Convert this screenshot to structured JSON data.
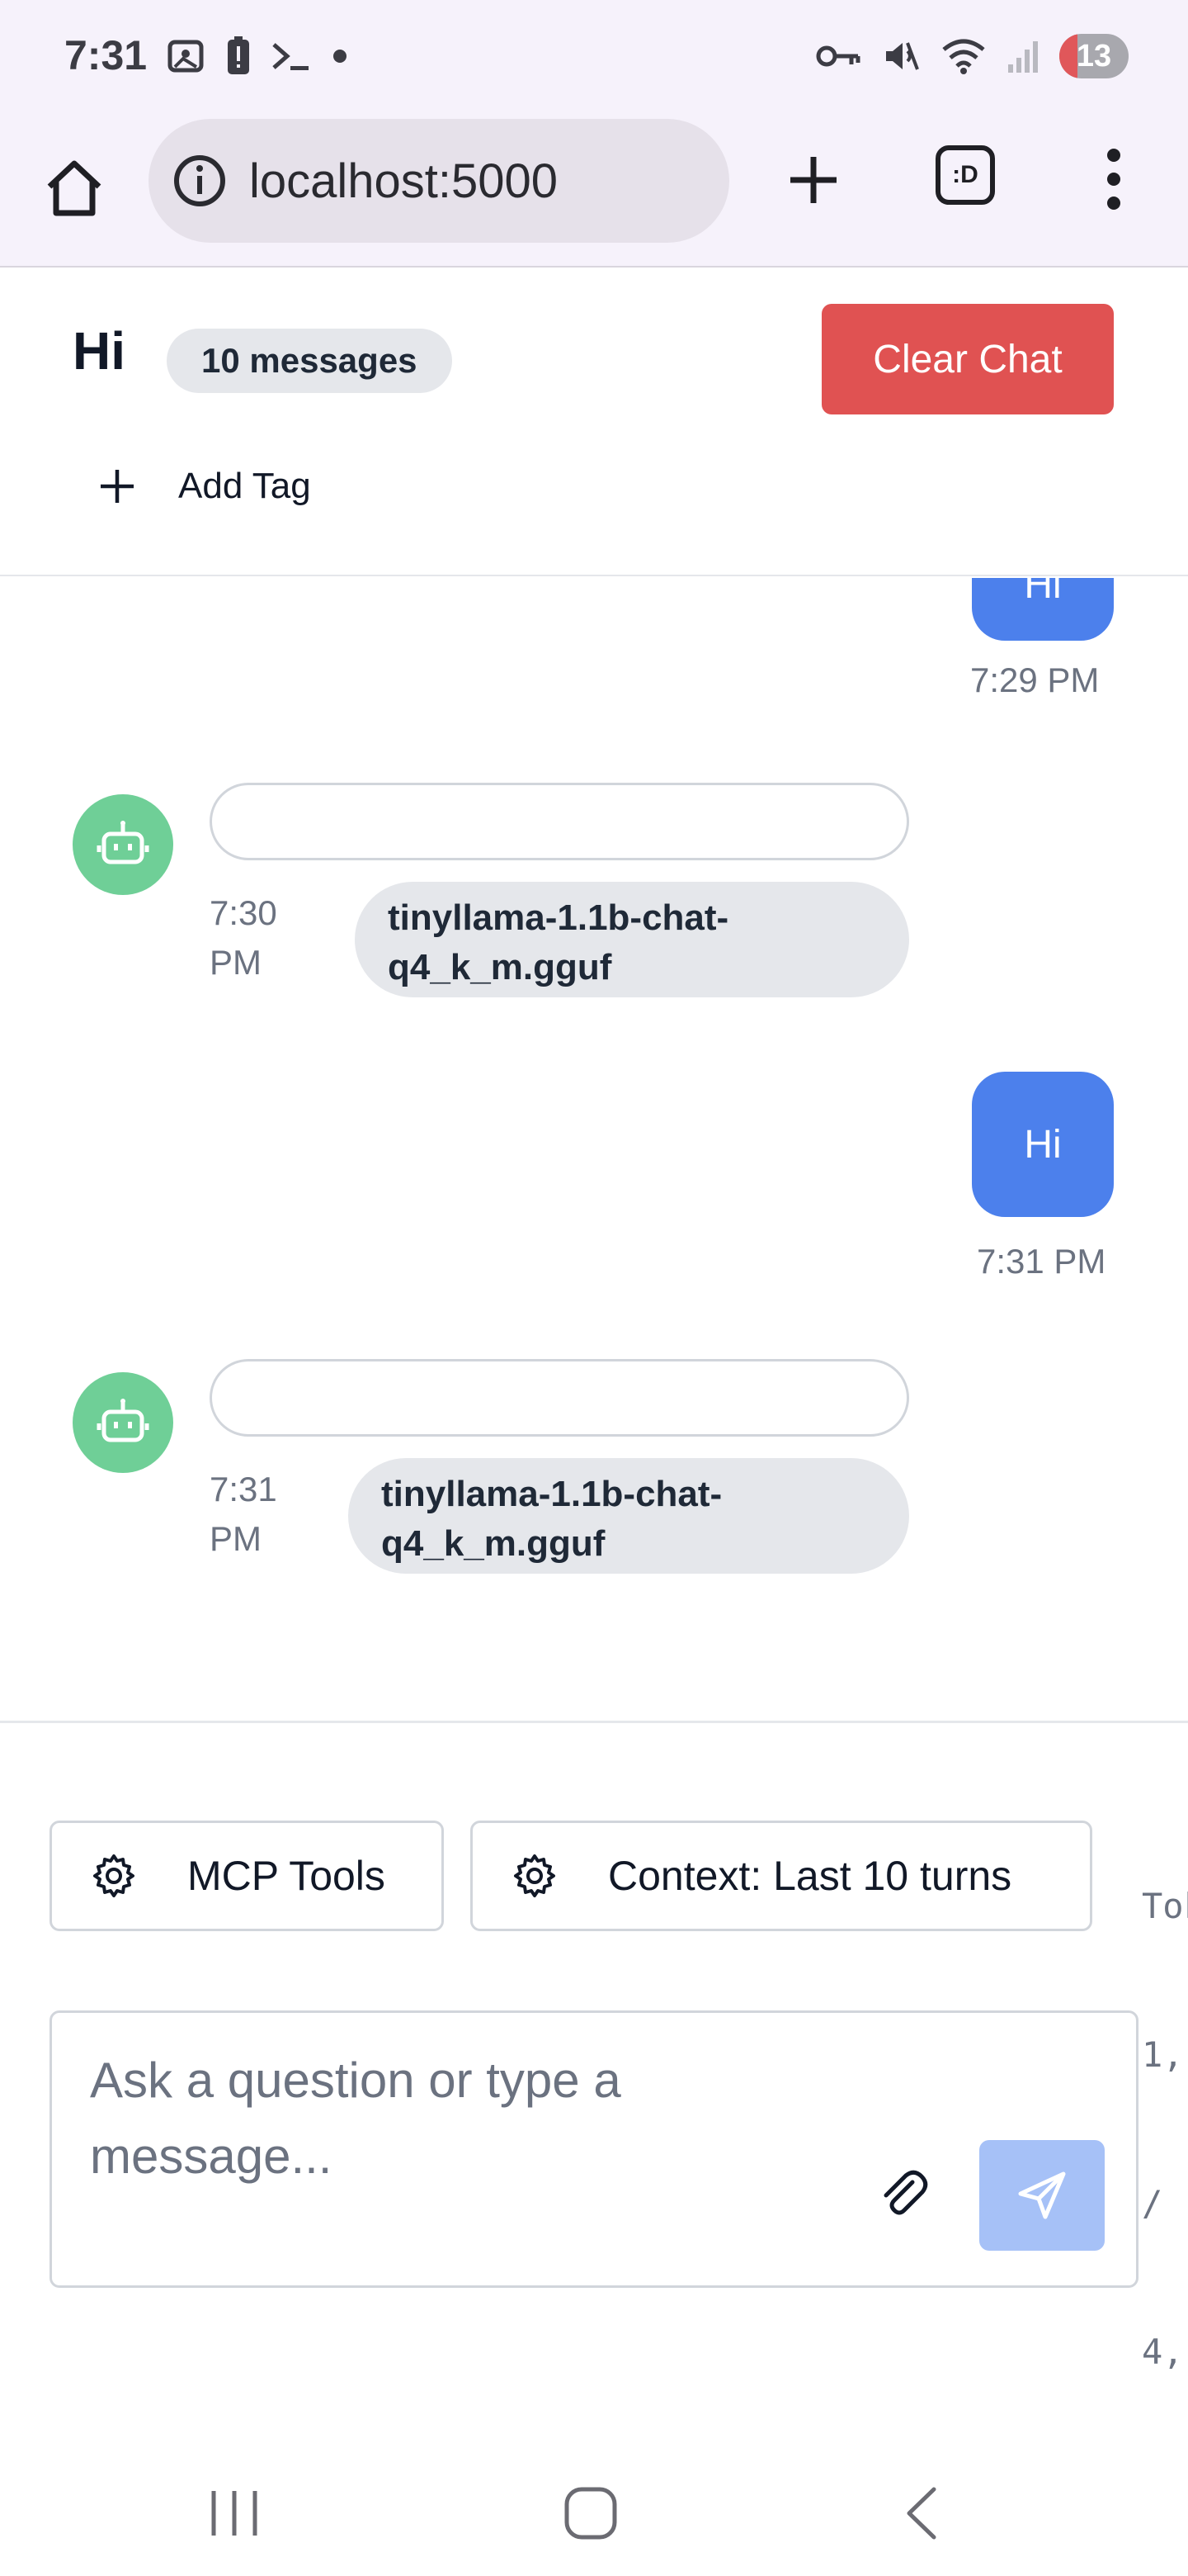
{
  "status_bar": {
    "time": "7:31",
    "notification_count": "13"
  },
  "browser": {
    "url": "localhost:5000",
    "tabs_label": ":D"
  },
  "chat": {
    "title": "Hi",
    "message_count": "10 messages",
    "clear_label": "Clear Chat",
    "add_tag_label": "Add Tag"
  },
  "messages": [
    {
      "role": "user",
      "text": "Hi",
      "time": "7:29 PM"
    },
    {
      "role": "assistant",
      "text": "",
      "time_line1": "7:30",
      "time_line2": "PM",
      "model_line1": "tinyllama-1.1b-chat-",
      "model_line2": "q4_k_m.gguf"
    },
    {
      "role": "user",
      "text": "Hi",
      "time": "7:31 PM"
    },
    {
      "role": "assistant",
      "text": "",
      "time_line1": "7:31",
      "time_line2": "PM",
      "model_line1": "tinyllama-1.1b-chat-",
      "model_line2": "q4_k_m.gguf"
    }
  ],
  "composer": {
    "mcp_tools_label": "MCP Tools",
    "context_label": "Context: Last 10 turns",
    "tokens_lines": [
      "Tok",
      "1,",
      "/",
      "4,"
    ],
    "placeholder_line1": "Ask a question or type a",
    "placeholder_line2": "message..."
  },
  "colors": {
    "user_bubble": "#4c80ec",
    "bot_avatar": "#6fcf97",
    "clear_button": "#e05252",
    "send_button_disabled": "#a6c1f7"
  }
}
